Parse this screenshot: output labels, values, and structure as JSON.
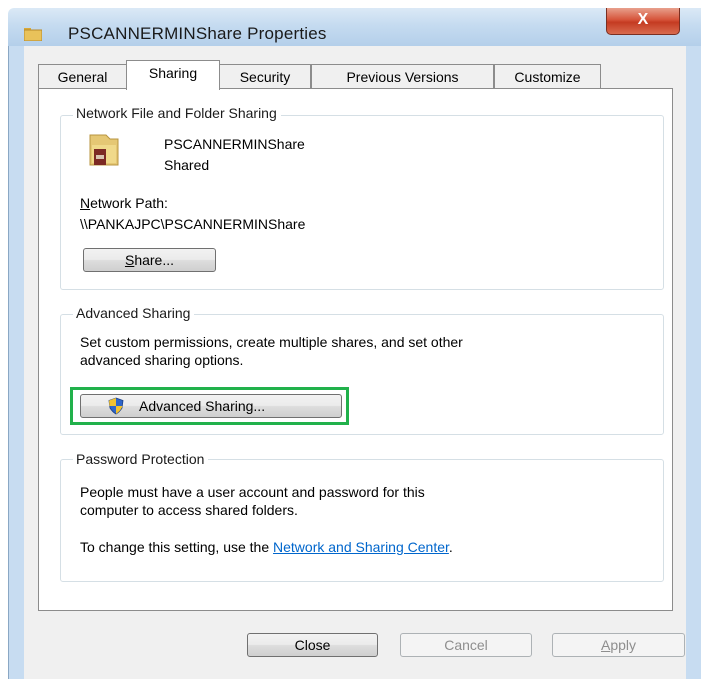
{
  "window": {
    "title": "PSCANNERMINShare Properties",
    "close_glyph": "X"
  },
  "tabs": [
    {
      "label": "General"
    },
    {
      "label": "Sharing"
    },
    {
      "label": "Security"
    },
    {
      "label": "Previous Versions"
    },
    {
      "label": "Customize"
    }
  ],
  "active_tab": "Sharing",
  "network_sharing": {
    "title": "Network File and Folder Sharing",
    "share_name": "PSCANNERMINShare",
    "share_status": "Shared",
    "path_label_prefix": "N",
    "path_label_rest": "etwork Path:",
    "path_value": "\\\\PANKAJPC\\PSCANNERMINShare",
    "share_button_accel": "S",
    "share_button_rest": "hare..."
  },
  "advanced_sharing": {
    "title": "Advanced Sharing",
    "desc_line1": "Set custom permissions, create multiple shares, and set other",
    "desc_line2": "advanced sharing options.",
    "button_label": "Advanced Sharing...",
    "highlight_color": "#21b14b"
  },
  "password_protection": {
    "title": "Password Protection",
    "line1": "People must have a user account and password for this",
    "line2": "computer to access shared folders.",
    "change_prefix": "To change this setting, use the ",
    "link_text": "Network and Sharing Center",
    "change_suffix": "."
  },
  "footer": {
    "close": "Close",
    "cancel": "Cancel",
    "apply_accel": "A",
    "apply_rest": "pply"
  },
  "icons": [
    "folder-icon",
    "shared-folder-icon",
    "uac-shield-icon",
    "close-icon"
  ]
}
